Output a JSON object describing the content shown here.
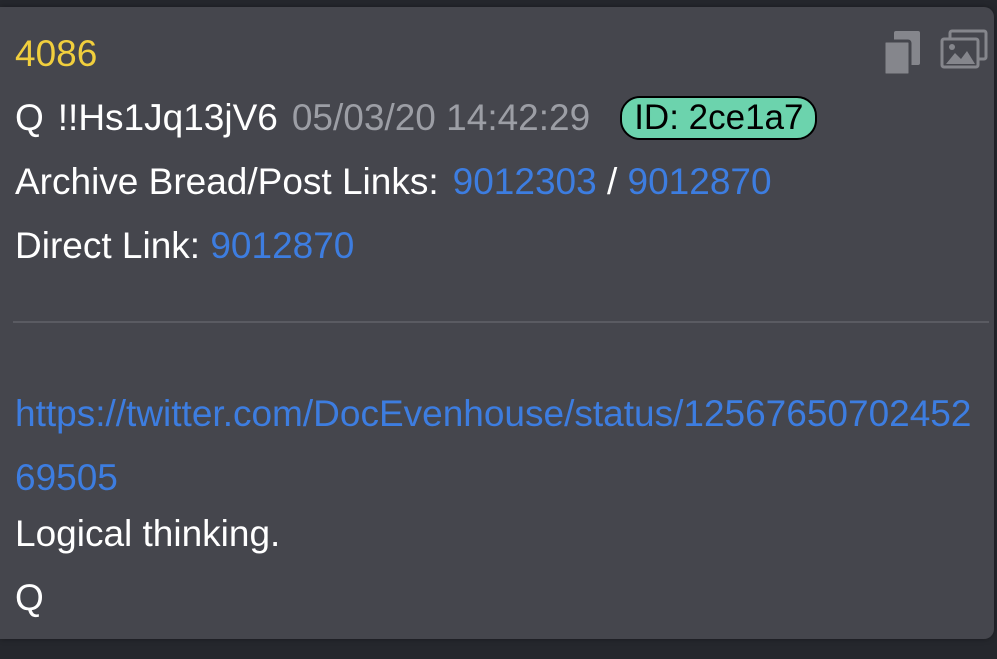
{
  "post": {
    "number": "4086",
    "author": "Q",
    "tripcode": "!!Hs1Jq13jV6",
    "timestamp": "05/03/20 14:42:29",
    "id_badge": "ID: 2ce1a7",
    "archive_label": "Archive Bread/Post Links:",
    "archive_link_1": "9012303",
    "archive_separator": "/",
    "archive_link_2": "9012870",
    "direct_label": "Direct Link:",
    "direct_link": "9012870",
    "body_url": "https://twitter.com/DocEvenhouse/status/1256765070245269505",
    "body_text": "Logical thinking.",
    "signature": "Q"
  },
  "icons": {
    "copy": "copy-icon",
    "gallery": "gallery-icon"
  },
  "colors": {
    "card_background": "#45464d",
    "page_background": "#25272d",
    "post_number": "#f1cf3d",
    "link": "#3d7de0",
    "timestamp": "#9c9ea5",
    "id_badge": "#6cd3ad"
  }
}
